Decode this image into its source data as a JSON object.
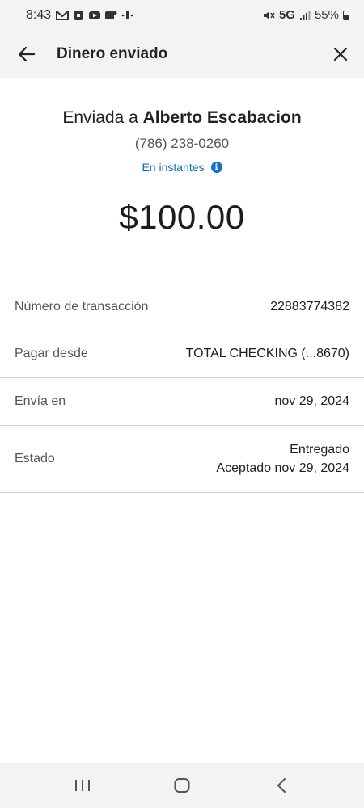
{
  "status_bar": {
    "time": "8:43",
    "network": "5G",
    "battery": "55%"
  },
  "app_bar": {
    "title": "Dinero enviado"
  },
  "header": {
    "sent_prefix": "Enviada a ",
    "recipient_name": "Alberto Escabacion",
    "phone": "(786) 238-0260",
    "speed_label": "En instantes",
    "amount": "$100.00"
  },
  "details": [
    {
      "label": "Número de transacción",
      "value": "22883774382"
    },
    {
      "label": "Pagar desde",
      "value": "TOTAL CHECKING (...8670)"
    },
    {
      "label": "Envía en",
      "value": "nov 29, 2024"
    },
    {
      "label": "Estado",
      "value_line1": "Entregado",
      "value_line2": "Aceptado nov 29, 2024"
    }
  ],
  "colors": {
    "accent": "#0b6fb8",
    "bar_background": "#f2f3f4"
  }
}
